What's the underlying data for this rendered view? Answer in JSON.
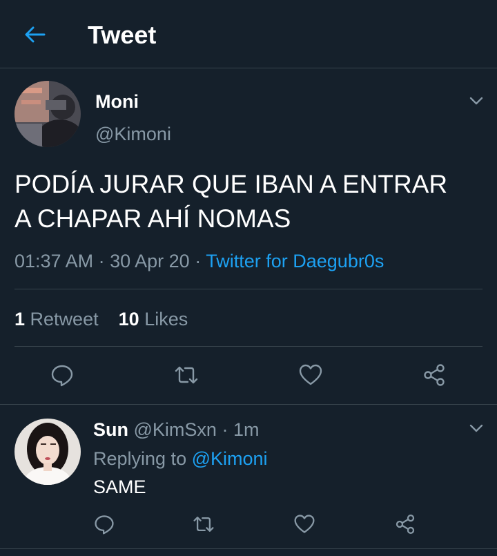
{
  "header": {
    "title": "Tweet",
    "back_icon": "arrow-left-icon"
  },
  "colors": {
    "background": "#15202b",
    "text": "#ffffff",
    "muted": "#8899a6",
    "accent": "#1da1f2",
    "divider": "#38444d"
  },
  "tweet": {
    "name": "Moni",
    "handle": "@Kimoni",
    "text_line1": "PODÍA JURAR QUE IBAN A ENTRAR",
    "text_line2": "A CHAPAR AHÍ NOMAS",
    "time": "01:37 AM",
    "dot1": "·",
    "date": "30 Apr 20",
    "dot2": "·",
    "source": "Twitter for Daegubr0s",
    "retweet_count": "1",
    "retweet_label": "Retweet",
    "like_count": "10",
    "like_label": "Likes"
  },
  "reply": {
    "name": "Sun",
    "handle": "@KimSxn",
    "dot": "·",
    "time": "1m",
    "replying_label": "Replying to",
    "replying_handle": "@Kimoni",
    "text": "SAME"
  }
}
